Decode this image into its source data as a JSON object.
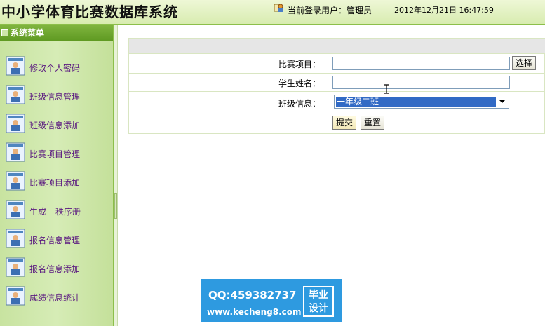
{
  "header": {
    "title": "中小学体育比赛数据库系统",
    "user_label": "当前登录用户：",
    "user_name": "管理员",
    "datetime": "2012年12月21日  16:47:59"
  },
  "sidebar": {
    "heading": "系统菜单",
    "items": [
      {
        "label": "修改个人密码"
      },
      {
        "label": "班级信息管理"
      },
      {
        "label": "班级信息添加"
      },
      {
        "label": "比赛项目管理"
      },
      {
        "label": "比赛项目添加"
      },
      {
        "label": "生成---秩序册"
      },
      {
        "label": "报名信息管理"
      },
      {
        "label": "报名信息添加"
      },
      {
        "label": "成绩信息统计"
      }
    ]
  },
  "form": {
    "event_label": "比赛项目：",
    "event_value": "",
    "choose_button": "选择",
    "student_label": "学生姓名：",
    "student_value": "",
    "class_label": "班级信息：",
    "class_selected": "一年级二班",
    "submit_button": "提交",
    "reset_button": "重置"
  },
  "watermark": {
    "qq": "QQ:459382737",
    "site": "www.kecheng8.com",
    "tag_line1": "毕业",
    "tag_line2": "设计"
  },
  "colors": {
    "menu_label": "#5a1880",
    "selection": "#316ac5",
    "badge": "#2e9ae0"
  }
}
